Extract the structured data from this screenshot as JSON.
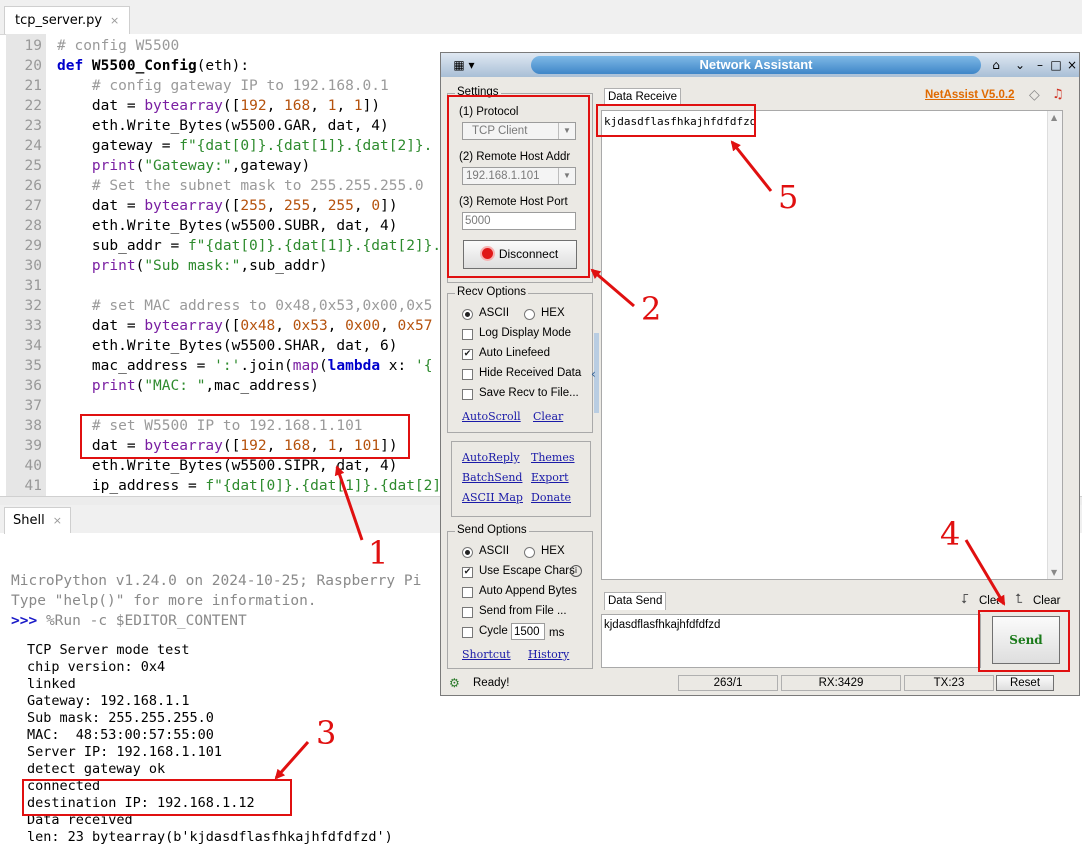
{
  "editor": {
    "tab_label": "tcp_server.py",
    "tab_close": "×",
    "lines": [
      {
        "n": "19",
        "segs": [
          {
            "t": "# config W5500",
            "c": "cm"
          }
        ]
      },
      {
        "n": "20",
        "segs": [
          {
            "t": "def ",
            "c": "kw"
          },
          {
            "t": "W5500_Config",
            "c": "fn"
          },
          {
            "t": "(eth):",
            "c": ""
          }
        ]
      },
      {
        "n": "21",
        "segs": [
          {
            "t": "    # config gateway IP to 192.168.0.1",
            "c": "cm"
          }
        ]
      },
      {
        "n": "22",
        "segs": [
          {
            "t": "    dat = ",
            "c": ""
          },
          {
            "t": "bytearray",
            "c": "bi"
          },
          {
            "t": "([",
            "c": ""
          },
          {
            "t": "192",
            "c": "nm"
          },
          {
            "t": ", ",
            "c": ""
          },
          {
            "t": "168",
            "c": "nm"
          },
          {
            "t": ", ",
            "c": ""
          },
          {
            "t": "1",
            "c": "nm"
          },
          {
            "t": ", ",
            "c": ""
          },
          {
            "t": "1",
            "c": "nm"
          },
          {
            "t": "])",
            "c": ""
          }
        ]
      },
      {
        "n": "23",
        "segs": [
          {
            "t": "    eth.Write_Bytes(w5500.GAR, dat, 4)",
            "c": ""
          }
        ]
      },
      {
        "n": "24",
        "segs": [
          {
            "t": "    gateway = ",
            "c": ""
          },
          {
            "t": "f\"{dat[0]}.{dat[1]}.{dat[2]}.",
            "c": "st"
          }
        ]
      },
      {
        "n": "25",
        "segs": [
          {
            "t": "    ",
            "c": ""
          },
          {
            "t": "print",
            "c": "bi"
          },
          {
            "t": "(",
            "c": ""
          },
          {
            "t": "\"Gateway:\"",
            "c": "st"
          },
          {
            "t": ",gateway)",
            "c": ""
          }
        ]
      },
      {
        "n": "26",
        "segs": [
          {
            "t": "    # Set the subnet mask to 255.255.255.0",
            "c": "cm"
          }
        ]
      },
      {
        "n": "27",
        "segs": [
          {
            "t": "    dat = ",
            "c": ""
          },
          {
            "t": "bytearray",
            "c": "bi"
          },
          {
            "t": "([",
            "c": ""
          },
          {
            "t": "255",
            "c": "nm"
          },
          {
            "t": ", ",
            "c": ""
          },
          {
            "t": "255",
            "c": "nm"
          },
          {
            "t": ", ",
            "c": ""
          },
          {
            "t": "255",
            "c": "nm"
          },
          {
            "t": ", ",
            "c": ""
          },
          {
            "t": "0",
            "c": "nm"
          },
          {
            "t": "])",
            "c": ""
          }
        ]
      },
      {
        "n": "28",
        "segs": [
          {
            "t": "    eth.Write_Bytes(w5500.SUBR, dat, 4)",
            "c": ""
          }
        ]
      },
      {
        "n": "29",
        "segs": [
          {
            "t": "    sub_addr = ",
            "c": ""
          },
          {
            "t": "f\"{dat[0]}.{dat[1]}.{dat[2]}.",
            "c": "st"
          }
        ]
      },
      {
        "n": "30",
        "segs": [
          {
            "t": "    ",
            "c": ""
          },
          {
            "t": "print",
            "c": "bi"
          },
          {
            "t": "(",
            "c": ""
          },
          {
            "t": "\"Sub mask:\"",
            "c": "st"
          },
          {
            "t": ",sub_addr)",
            "c": ""
          }
        ]
      },
      {
        "n": "31",
        "segs": []
      },
      {
        "n": "32",
        "segs": [
          {
            "t": "    # set MAC address to 0x48,0x53,0x00,0x5",
            "c": "cm"
          }
        ]
      },
      {
        "n": "33",
        "segs": [
          {
            "t": "    dat = ",
            "c": ""
          },
          {
            "t": "bytearray",
            "c": "bi"
          },
          {
            "t": "([",
            "c": ""
          },
          {
            "t": "0x48",
            "c": "nm"
          },
          {
            "t": ", ",
            "c": ""
          },
          {
            "t": "0x53",
            "c": "nm"
          },
          {
            "t": ", ",
            "c": ""
          },
          {
            "t": "0x00",
            "c": "nm"
          },
          {
            "t": ", ",
            "c": ""
          },
          {
            "t": "0x57",
            "c": "nm"
          }
        ]
      },
      {
        "n": "34",
        "segs": [
          {
            "t": "    eth.Write_Bytes(w5500.SHAR, dat, 6)",
            "c": ""
          }
        ]
      },
      {
        "n": "35",
        "segs": [
          {
            "t": "    mac_address = ",
            "c": ""
          },
          {
            "t": "':'",
            "c": "st"
          },
          {
            "t": ".join(",
            "c": ""
          },
          {
            "t": "map",
            "c": "bi"
          },
          {
            "t": "(",
            "c": ""
          },
          {
            "t": "lambda",
            "c": "kw"
          },
          {
            "t": " x: ",
            "c": ""
          },
          {
            "t": "'{",
            "c": "st"
          }
        ]
      },
      {
        "n": "36",
        "segs": [
          {
            "t": "    ",
            "c": ""
          },
          {
            "t": "print",
            "c": "bi"
          },
          {
            "t": "(",
            "c": ""
          },
          {
            "t": "\"MAC: \"",
            "c": "st"
          },
          {
            "t": ",mac_address)",
            "c": ""
          }
        ]
      },
      {
        "n": "37",
        "segs": []
      },
      {
        "n": "38",
        "segs": [
          {
            "t": "    # set W5500 IP to 192.168.1.101",
            "c": "cm"
          }
        ]
      },
      {
        "n": "39",
        "segs": [
          {
            "t": "    dat = ",
            "c": ""
          },
          {
            "t": "bytearray",
            "c": "bi"
          },
          {
            "t": "([",
            "c": ""
          },
          {
            "t": "192",
            "c": "nm"
          },
          {
            "t": ", ",
            "c": ""
          },
          {
            "t": "168",
            "c": "nm"
          },
          {
            "t": ", ",
            "c": ""
          },
          {
            "t": "1",
            "c": "nm"
          },
          {
            "t": ", ",
            "c": ""
          },
          {
            "t": "101",
            "c": "nm"
          },
          {
            "t": "])",
            "c": ""
          }
        ]
      },
      {
        "n": "40",
        "segs": [
          {
            "t": "    eth.Write_Bytes(w5500.SIPR, dat, 4)",
            "c": ""
          }
        ]
      },
      {
        "n": "41",
        "segs": [
          {
            "t": "    ip_address = ",
            "c": ""
          },
          {
            "t": "f\"{dat[0]}.{dat[1]}.{dat[2]}",
            "c": "st"
          }
        ]
      }
    ]
  },
  "shell": {
    "tab_label": "Shell",
    "tab_close": "×",
    "banner_1": "MicroPython v1.24.0 on 2024-10-25; Raspberry Pi",
    "banner_2": "Type \"help()\" for more information.",
    "prompt": ">>>",
    "command": "%Run -c $EDITOR_CONTENT",
    "output": [
      "TCP Server mode test",
      "chip version: 0x4",
      "linked",
      "Gateway: 192.168.1.1",
      "Sub mask: 255.255.255.0",
      "MAC:  48:53:00:57:55:00",
      "Server IP: 192.168.1.101",
      "detect gateway ok",
      "connected",
      "destination IP: 192.168.1.12",
      "Data received",
      "len: 23 bytearray(b'kjdasdflasfhkajhfdfdfzd')"
    ]
  },
  "netassist": {
    "title": "Network Assistant",
    "version": "NetAssist V5.0.2",
    "settings": {
      "legend": "Settings",
      "protocol_label": "(1) Protocol",
      "protocol_value": "TCP Client",
      "host_label": "(2) Remote Host Addr",
      "host_value": "192.168.1.101",
      "port_label": "(3) Remote Host Port",
      "port_value": "5000",
      "disconnect": "Disconnect"
    },
    "recv_options": {
      "legend": "Recv Options",
      "ascii": "ASCII",
      "hex": "HEX",
      "log_display": "Log Display Mode",
      "auto_linefeed": "Auto Linefeed",
      "hide_received": "Hide Received Data",
      "save_recv": "Save Recv to File...",
      "autoscroll": "AutoScroll",
      "clear": "Clear"
    },
    "tools": {
      "autoreply": "AutoReply",
      "themes": "Themes",
      "batchsend": "BatchSend",
      "export": "Export",
      "asciimap": "ASCII Map",
      "donate": "Donate"
    },
    "send_options": {
      "legend": "Send Options",
      "ascii": "ASCII",
      "hex": "HEX",
      "escape": "Use Escape Chars",
      "append": "Auto Append Bytes",
      "from_file": "Send from File ...",
      "cycle": "Cycle",
      "cycle_value": "1500",
      "cycle_unit": "ms",
      "shortcut": "Shortcut",
      "history": "History"
    },
    "data_receive": {
      "tab": "Data Receive",
      "content": "kjdasdflasfhkajhfdfdfzd"
    },
    "data_send": {
      "tab": "Data Send",
      "clear1": "Clear",
      "clear2": "Clear",
      "content": "kjdasdflasfhkajhfdfdfzd",
      "send": "Send"
    },
    "status": {
      "ready": "Ready!",
      "pos": "263/1",
      "rx": "RX:3429",
      "tx": "TX:23",
      "reset": "Reset"
    }
  },
  "annotations": {
    "n1": "1",
    "n2": "2",
    "n3": "3",
    "n4": "4",
    "n5": "5",
    "color": "#e01010"
  }
}
